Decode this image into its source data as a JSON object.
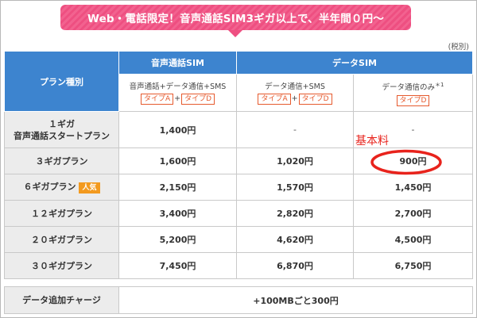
{
  "banner": {
    "text": "Web・電話限定！音声通話SIM3ギガ以上で、半年間０円〜"
  },
  "tax_note": "(税別)",
  "header": {
    "plan_type": "プラン種別",
    "voice_sim": "音声通話SIM",
    "data_sim": "データSIM",
    "sub_voice": "音声通話+データ通信+SMS",
    "sub_data_sms": "データ通信+SMS",
    "sub_data_only": "データ通信のみ",
    "sub_data_only_note": "＊1",
    "type_a": "タイプA",
    "type_d": "タイプD",
    "plus": "+"
  },
  "rows": [
    {
      "plan_line1": "１ギガ",
      "plan_line2": "音声通話スタートプラン",
      "voice": "1,400円",
      "data_sms": "-",
      "data_only": "-"
    },
    {
      "plan": "３ギガプラン",
      "voice": "1,600円",
      "data_sms": "1,020円",
      "data_only": "900円"
    },
    {
      "plan": "６ギガプラン",
      "badge": "人気",
      "voice": "2,150円",
      "data_sms": "1,570円",
      "data_only": "1,450円"
    },
    {
      "plan": "１２ギガプラン",
      "voice": "3,400円",
      "data_sms": "2,820円",
      "data_only": "2,700円"
    },
    {
      "plan": "２０ギガプラン",
      "voice": "5,200円",
      "data_sms": "4,620円",
      "data_only": "4,500円"
    },
    {
      "plan": "３０ギガプラン",
      "voice": "7,450円",
      "data_sms": "6,870円",
      "data_only": "6,750円"
    }
  ],
  "annotation": {
    "text": "基本料",
    "circle_color": "#e8231c"
  },
  "charge": {
    "label": "データ追加チャージ",
    "value": "+100MBごと300円"
  },
  "colors": {
    "header_blue": "#3d84cf",
    "banner_pink": "#ee4f81",
    "tag_orange": "#e65a2e",
    "popular_orange": "#f39a1f"
  }
}
